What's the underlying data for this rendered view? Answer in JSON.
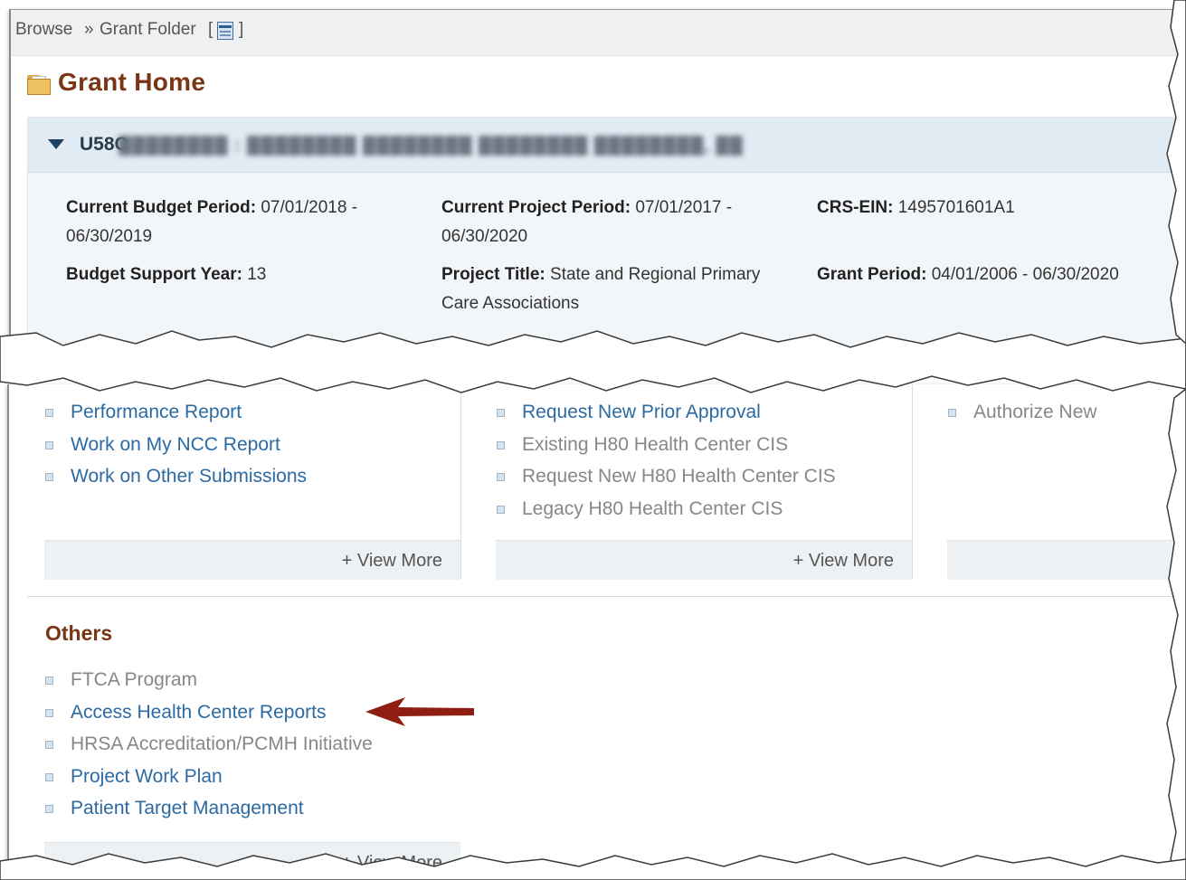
{
  "breadcrumb": {
    "browse": "Browse",
    "separator": "»",
    "folder": "Grant Folder",
    "bracket_open": "[",
    "bracket_close": "]"
  },
  "page_title": "Grant Home",
  "grant": {
    "id_prefix": "U58C",
    "fields": {
      "current_budget_period": {
        "label": "Current Budget Period:",
        "value": "07/01/2018 -",
        "value2": "06/30/2019"
      },
      "current_project_period": {
        "label": "Current Project Period:",
        "value": "07/01/2017 -",
        "value2": "06/30/2020"
      },
      "crs_ein": {
        "label": "CRS-EIN:",
        "value": "1495701601A1"
      },
      "budget_support_year": {
        "label": "Budget Support Year:",
        "value": "13"
      },
      "project_title": {
        "label": "Project Title:",
        "value": "State and Regional Primary",
        "value2": "Care Associations"
      },
      "grant_period": {
        "label": "Grant Period:",
        "value": "04/01/2006 - 06/30/2020"
      }
    }
  },
  "col1_links": [
    {
      "label": "Performance Report",
      "enabled": true
    },
    {
      "label": "Work on My NCC Report",
      "enabled": true
    },
    {
      "label": "Work on Other Submissions",
      "enabled": true
    }
  ],
  "col2_links": [
    {
      "label": "Request New Prior Approval",
      "enabled": true
    },
    {
      "label": "Existing H80 Health Center CIS",
      "enabled": false
    },
    {
      "label": "Request New H80 Health Center CIS",
      "enabled": false
    },
    {
      "label": "Legacy H80 Health Center CIS",
      "enabled": false
    }
  ],
  "col3_links": [
    {
      "label": "Authorize New",
      "enabled": false
    }
  ],
  "view_more_label": "+ View More",
  "others": {
    "title": "Others",
    "links": [
      {
        "label": "FTCA Program",
        "enabled": false
      },
      {
        "label": "Access Health Center Reports",
        "enabled": true
      },
      {
        "label": "HRSA Accreditation/PCMH Initiative",
        "enabled": false
      },
      {
        "label": "Project Work Plan",
        "enabled": true
      },
      {
        "label": "Patient Target Management",
        "enabled": true
      }
    ],
    "view_more_label": "+ View More"
  },
  "colors": {
    "link_blue": "#2b6aa2",
    "disabled_gray": "#878787",
    "title_brown": "#7a3514",
    "arrow_red": "#8e1d12"
  },
  "icons": [
    "grant-folder-icon",
    "folder-icon",
    "caret-down-icon",
    "bullet-icon",
    "red-arrow-icon"
  ]
}
